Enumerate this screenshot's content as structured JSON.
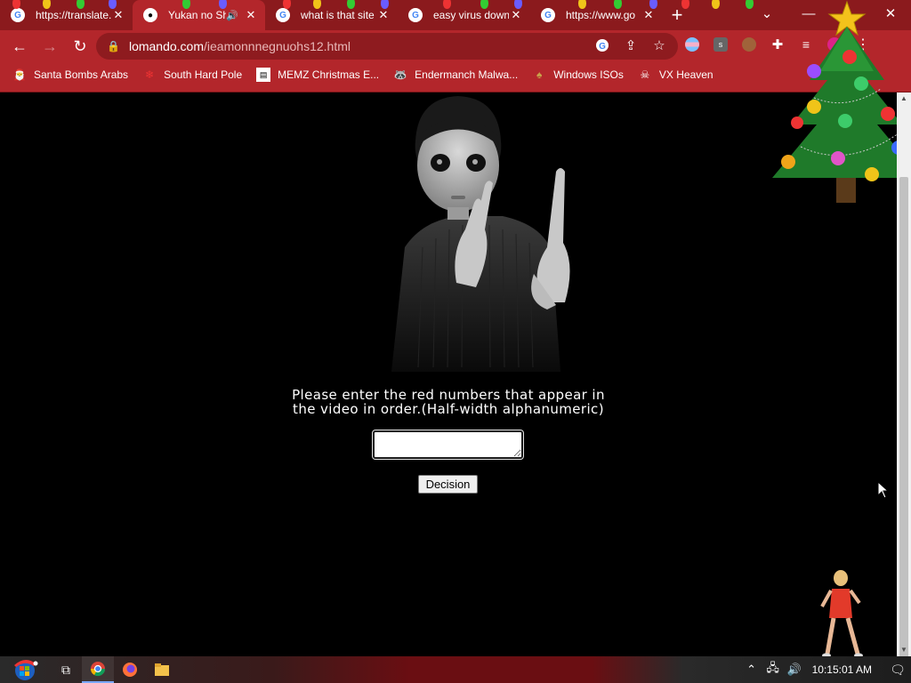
{
  "window": {
    "minimize_glyph": "—",
    "close_glyph": "✕",
    "tab_search_glyph": "⌄"
  },
  "tabs": [
    {
      "title": "https://translate.",
      "favicon": "google-translate-icon",
      "active": false
    },
    {
      "title": "Yukan no Sh",
      "favicon": "panda-icon",
      "active": true,
      "audio": true
    },
    {
      "title": "what is that site",
      "favicon": "google-icon",
      "active": false
    },
    {
      "title": "easy virus down",
      "favicon": "google-icon",
      "active": false
    },
    {
      "title": "https://www.go",
      "favicon": "google-icon",
      "active": false
    }
  ],
  "new_tab_label": "+",
  "toolbar": {
    "back_glyph": "←",
    "forward_glyph": "→",
    "reload_glyph": "↻",
    "url_host": "lomando.com",
    "url_path": "/ieamonnnegnuohs12.html",
    "menu_glyph": "⋮"
  },
  "bookmarks": [
    {
      "label": "Santa Bombs Arabs",
      "icon": "santa-icon"
    },
    {
      "label": "South Hard Pole",
      "icon": "snowflake-icon"
    },
    {
      "label": "MEMZ Christmas E...",
      "icon": "page-icon"
    },
    {
      "label": "Endermanch Malwa...",
      "icon": "raccoon-icon"
    },
    {
      "label": "Windows ISOs",
      "icon": "gnome-icon"
    },
    {
      "label": "VX Heaven",
      "icon": "skull-icon"
    }
  ],
  "page": {
    "prompt_line1": "Please enter the red numbers that appear in",
    "prompt_line2": "the video in order.(Half-width alphanumeric)",
    "answer_value": "",
    "decision_label": "Decision"
  },
  "taskbar": {
    "clock": "10:15:01 AM"
  },
  "colors": {
    "titlebar": "#8b1a1d",
    "toolbar": "#b3262b",
    "page_bg": "#000000"
  }
}
